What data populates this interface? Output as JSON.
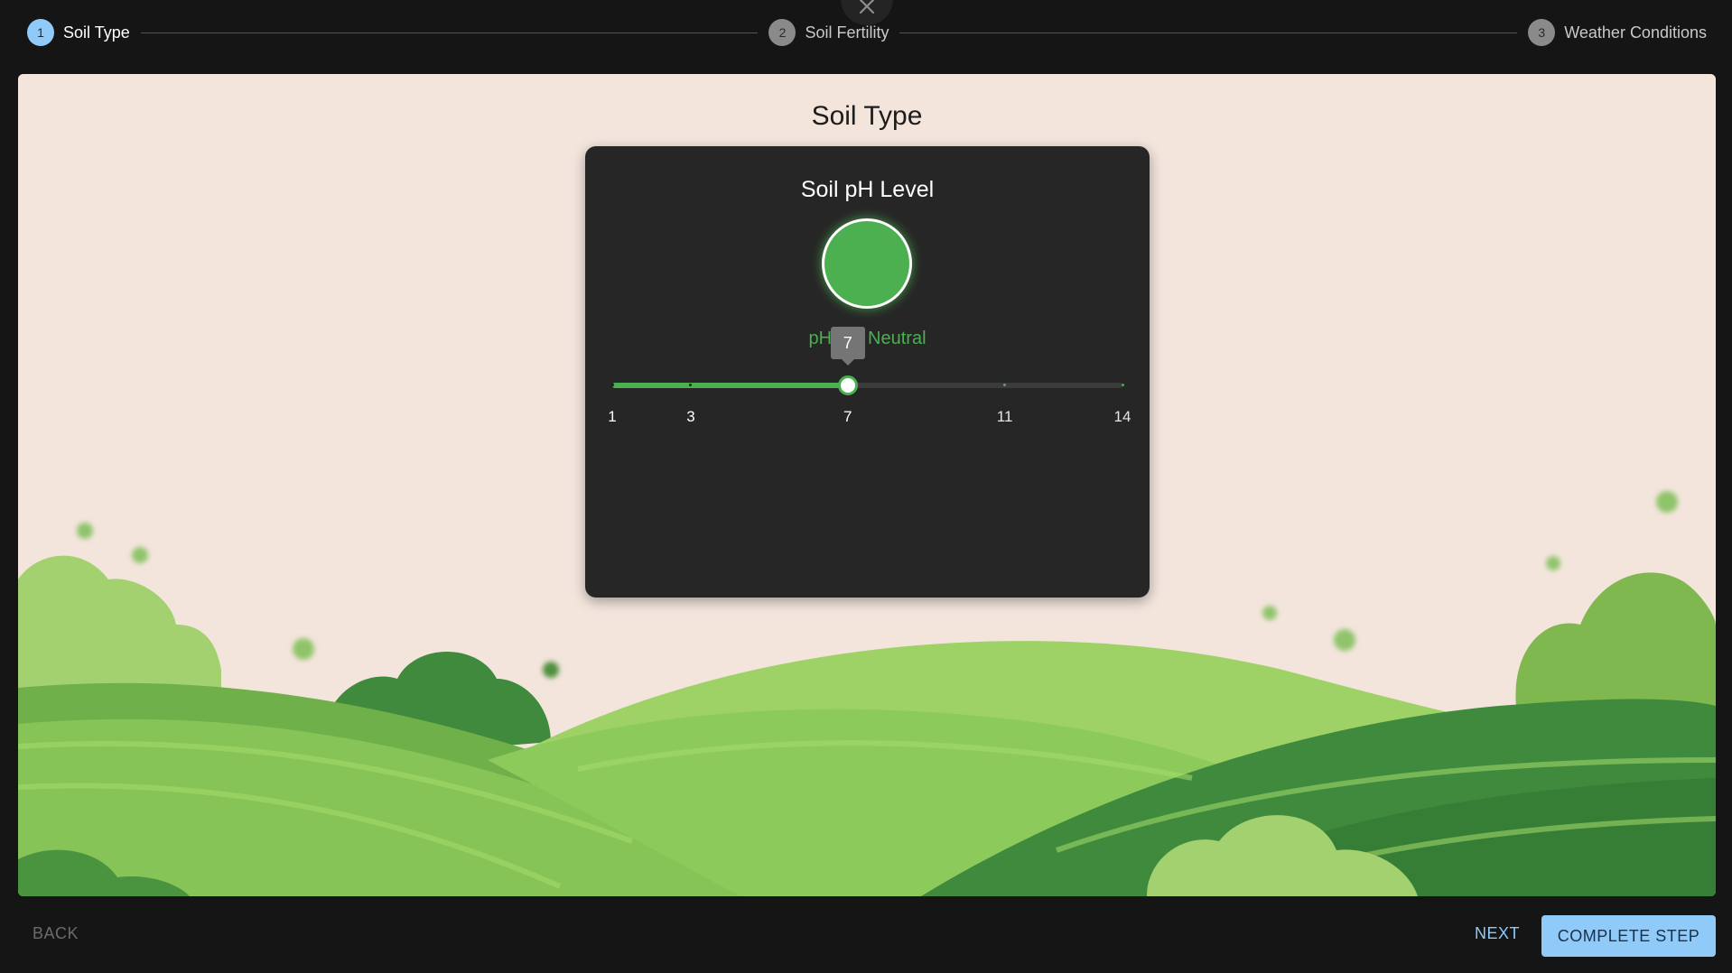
{
  "stepper": {
    "steps": [
      {
        "number": "1",
        "label": "Soil Type",
        "state": "active"
      },
      {
        "number": "2",
        "label": "Soil Fertility",
        "state": "inactive"
      },
      {
        "number": "3",
        "label": "Weather Conditions",
        "state": "inactive"
      }
    ],
    "close_icon": "close-icon"
  },
  "main": {
    "title": "Soil Type",
    "card": {
      "title": "Soil pH Level",
      "indicator_color": "#4caf50",
      "readout_prefix": "pH: ",
      "readout_suffix": " - Neutral",
      "slider": {
        "min": 1,
        "max": 14,
        "value": 7,
        "value_label": "7",
        "marks": [
          {
            "value": 1,
            "label": "1"
          },
          {
            "value": 3,
            "label": "3"
          },
          {
            "value": 7,
            "label": "7"
          },
          {
            "value": 11,
            "label": "11"
          },
          {
            "value": 14,
            "label": "14"
          }
        ]
      }
    }
  },
  "footer": {
    "back_label": "BACK",
    "next_label": "NEXT",
    "complete_label": "COMPLETE STEP"
  },
  "colors": {
    "accent": "#90caf9",
    "success": "#4caf50",
    "panel_background": "#f3e5dc",
    "card_background": "#262626"
  }
}
